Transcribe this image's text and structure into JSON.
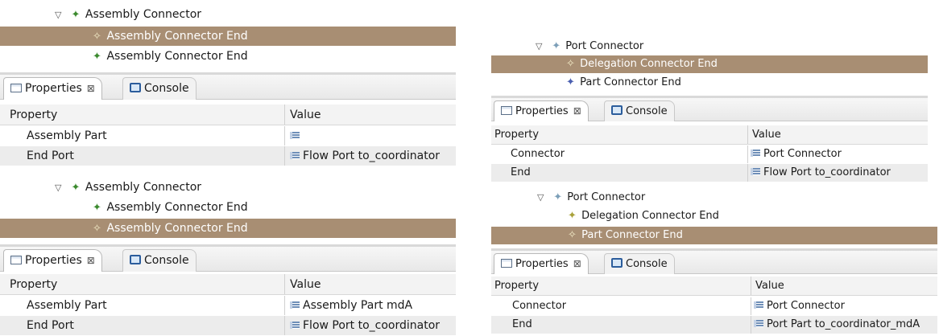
{
  "panels": {
    "tl": {
      "tree": [
        {
          "label": "Assembly Connector",
          "icon": "assembly-connector-icon",
          "expanded": true
        },
        {
          "label": "Assembly Connector End",
          "icon": "assembly-connector-end-icon",
          "selected": true
        },
        {
          "label": "Assembly Connector End",
          "icon": "assembly-connector-end-icon"
        }
      ],
      "tabs": [
        {
          "label": "Properties",
          "close": "⊠"
        },
        {
          "label": "Console"
        }
      ],
      "headers": {
        "property": "Property",
        "value": "Value"
      },
      "rows": [
        {
          "property": "Assembly Part",
          "value": ""
        },
        {
          "property": "End Port",
          "value": "Flow Port to_coordinator"
        }
      ]
    },
    "bl": {
      "tree": [
        {
          "label": "Assembly Connector",
          "icon": "assembly-connector-icon",
          "expanded": true
        },
        {
          "label": "Assembly Connector End",
          "icon": "assembly-connector-end-icon"
        },
        {
          "label": "Assembly Connector End",
          "icon": "assembly-connector-end-icon",
          "selected": true
        }
      ],
      "tabs": [
        {
          "label": "Properties",
          "close": "⊠"
        },
        {
          "label": "Console"
        }
      ],
      "headers": {
        "property": "Property",
        "value": "Value"
      },
      "rows": [
        {
          "property": "Assembly Part",
          "value": "Assembly Part mdA"
        },
        {
          "property": "End Port",
          "value": "Flow Port to_coordinator"
        }
      ]
    },
    "tr": {
      "tree": [
        {
          "label": "Port Connector",
          "icon": "port-connector-icon",
          "expanded": true
        },
        {
          "label": "Delegation Connector End",
          "icon": "delegation-connector-end-icon",
          "selected": true
        },
        {
          "label": "Part Connector End",
          "icon": "part-connector-end-icon"
        }
      ],
      "tabs": [
        {
          "label": "Properties",
          "close": "⊠"
        },
        {
          "label": "Console"
        }
      ],
      "headers": {
        "property": "Property",
        "value": "Value"
      },
      "rows": [
        {
          "property": "Connector",
          "value": "Port Connector"
        },
        {
          "property": "End",
          "value": "Flow Port to_coordinator"
        }
      ]
    },
    "br": {
      "tree": [
        {
          "label": "Port Connector",
          "icon": "port-connector-icon",
          "expanded": true
        },
        {
          "label": "Delegation Connector End",
          "icon": "delegation-connector-end-icon"
        },
        {
          "label": "Part Connector End",
          "icon": "part-connector-end-icon",
          "selected": true
        }
      ],
      "tabs": [
        {
          "label": "Properties",
          "close": "⊠"
        },
        {
          "label": "Console"
        }
      ],
      "headers": {
        "property": "Property",
        "value": "Value"
      },
      "rows": [
        {
          "property": "Connector",
          "value": "Port Connector"
        },
        {
          "property": "End",
          "value": "Port Part to_coordinator_mdA"
        }
      ]
    }
  }
}
